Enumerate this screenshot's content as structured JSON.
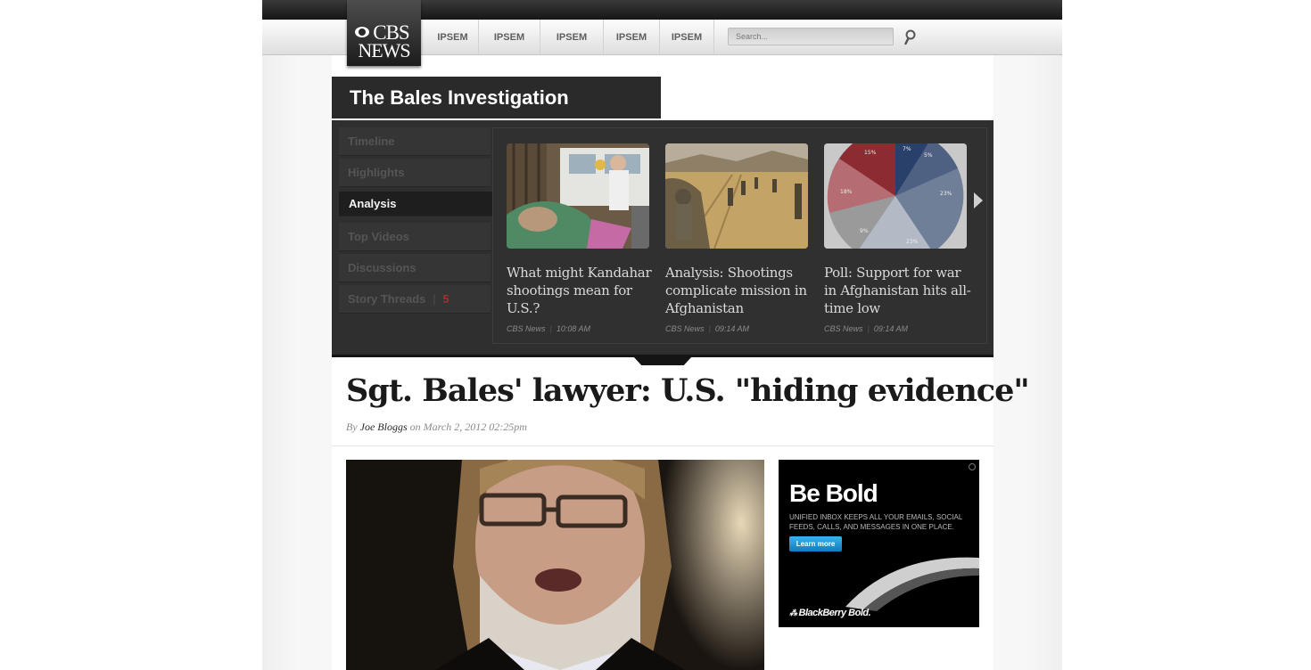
{
  "header": {
    "logo": {
      "line1": "CBS",
      "line2": "NEWS"
    },
    "nav_items": [
      "IPSEM",
      "IPSEM",
      "IPSEM",
      "IPSEM",
      "IPSEM"
    ],
    "search_placeholder": "Search..."
  },
  "section": {
    "title": "The Bales Investigation",
    "sidebar_items": [
      {
        "label": "Timeline",
        "active": false
      },
      {
        "label": "Highlights",
        "active": false
      },
      {
        "label": "Analysis",
        "active": true
      },
      {
        "label": "Top Videos",
        "active": false
      },
      {
        "label": "Discussions",
        "active": false
      },
      {
        "label": "Story Threads",
        "count": "5",
        "active": false
      }
    ],
    "cards": [
      {
        "title": "What might Kandahar shootings mean for U.S.?",
        "source": "CBS News",
        "time": "10:08 AM",
        "image_icon": "wounded-child-photo"
      },
      {
        "title": "Analysis: Shootings complicate mission in Afghanistan",
        "source": "CBS News",
        "time": "09:14 AM",
        "image_icon": "soldiers-patrol-photo"
      },
      {
        "title": "Poll: Support for war in Afghanistan hits all-time low",
        "source": "CBS News",
        "time": "09:14 AM",
        "image_icon": "pie-chart-graphic"
      }
    ],
    "pie_labels": [
      "15%",
      "7%",
      "5%",
      "18%",
      "23%",
      "9%",
      "23%"
    ]
  },
  "article": {
    "headline": "Sgt. Bales' lawyer: U.S. \"hiding evidence\"",
    "byline_prefix": "By",
    "author": "Joe Bloggs",
    "date_text": "on March 2, 2012 02:25pm"
  },
  "ad": {
    "title": "Be Bold",
    "body": "UNIFIED INBOX KEEPS ALL YOUR EMAILS, SOCIAL FEEDS, CALLS, AND MESSAGES IN ONE PLACE.",
    "button": "Learn more",
    "brand": "BlackBerry Bold."
  },
  "colors": {
    "topbar": "#1c1c1c",
    "panel": "#2f2f2f",
    "accent_count": "#9b3232",
    "ad_button": "#1f8fd0"
  }
}
